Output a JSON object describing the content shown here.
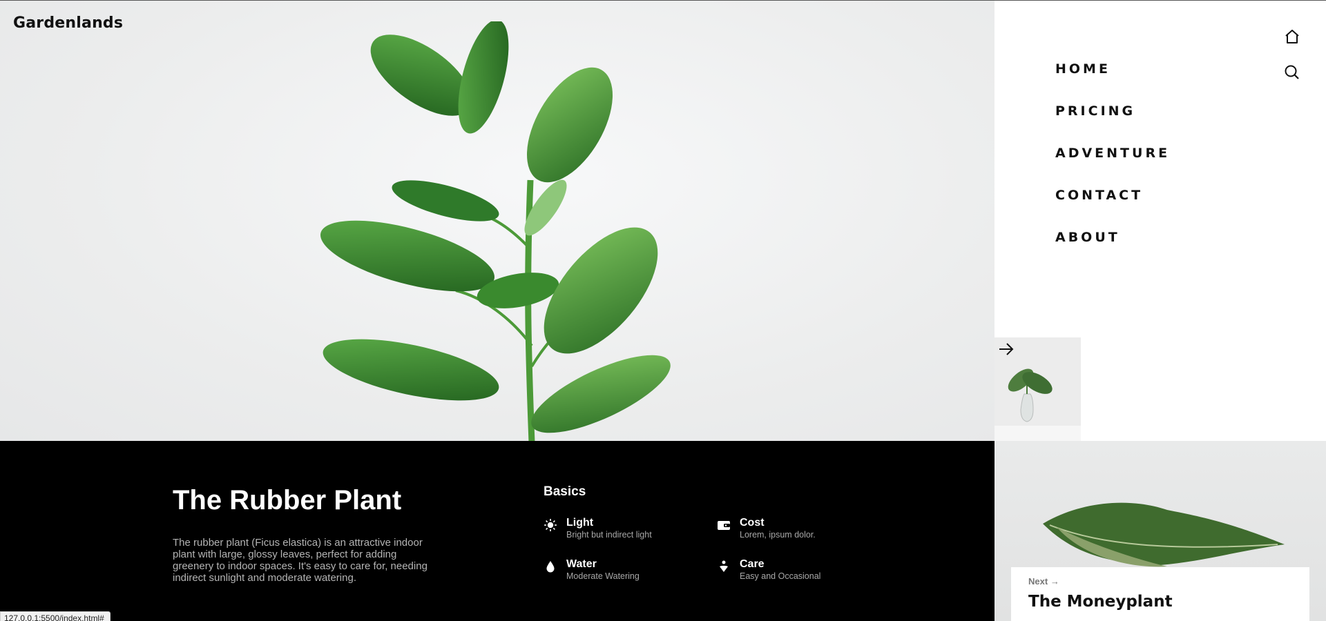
{
  "brand": "Gardenlands",
  "nav": {
    "items": [
      "HOME",
      "PRICING",
      "ADVENTURE",
      "CONTACT",
      "ABOUT"
    ],
    "icons": [
      "home-icon",
      "search-icon"
    ]
  },
  "plant": {
    "title": "The Rubber Plant",
    "description": "The rubber plant (Ficus elastica) is an attractive indoor plant with large, glossy leaves, perfect for adding greenery to indoor spaces. It's easy to care for, needing indirect sunlight and moderate watering."
  },
  "basics": {
    "title": "Basics",
    "items": [
      {
        "name": "Light",
        "desc": "Bright but indirect light",
        "icon": "sun-icon"
      },
      {
        "name": "Cost",
        "desc": "Lorem, ipsum dolor.",
        "icon": "wallet-icon"
      },
      {
        "name": "Water",
        "desc": "Moderate Watering",
        "icon": "water-drop-icon"
      },
      {
        "name": "Care",
        "desc": "Easy and Occasional",
        "icon": "care-icon"
      }
    ]
  },
  "next": {
    "label": "Next",
    "title": "The Moneyplant"
  },
  "status_url": "127.0.0.1:5500/index.html#",
  "colors": {
    "accent": "#000000",
    "leaf": "#3a8a2e",
    "hero_bg": "#eceded"
  }
}
